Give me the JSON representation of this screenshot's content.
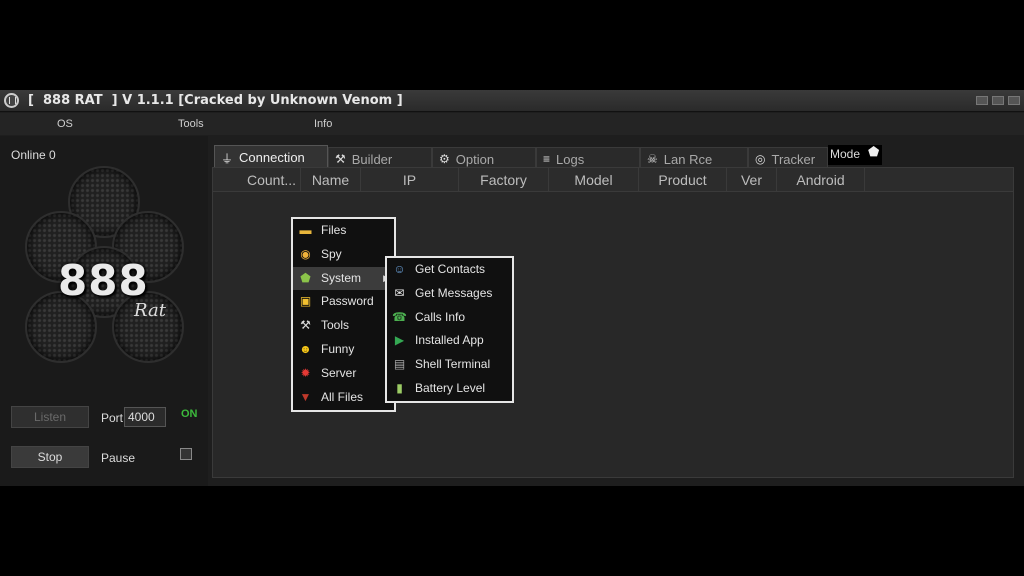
{
  "window": {
    "title": "[  888 RAT  ] V 1.1.1 [Cracked by Unknown Venom ]",
    "menu": [
      "OS",
      "Tools",
      "Info"
    ]
  },
  "sidebar": {
    "online_label": "Online 0",
    "logo_text": "888",
    "logo_sub": "Rat",
    "listen_label": "Listen",
    "stop_label": "Stop",
    "port_label": "Port",
    "port_value": "4000",
    "status_on": "ON",
    "pause_label": "Pause"
  },
  "tabs": [
    {
      "label": "Connection",
      "icon": "plug-icon",
      "active": true
    },
    {
      "label": "Builder",
      "icon": "tools-icon"
    },
    {
      "label": "Option",
      "icon": "gear-icon"
    },
    {
      "label": "Logs",
      "icon": "database-icon"
    },
    {
      "label": "Lan Rce",
      "icon": "skull-icon"
    },
    {
      "label": "Tracker",
      "icon": "globe-icon"
    }
  ],
  "mode_label": "Mode",
  "columns": [
    "Count...",
    "Name",
    "IP",
    "Factory",
    "Model",
    "Product",
    "Ver",
    "Android"
  ],
  "context_menu": [
    {
      "label": "Files",
      "icon": "folder-icon",
      "color": "#e8b63c"
    },
    {
      "label": "Spy",
      "icon": "eye-icon",
      "color": "#f0b23a"
    },
    {
      "label": "System",
      "icon": "android-icon",
      "color": "#8bc34a",
      "submenu": true
    },
    {
      "label": "Password",
      "icon": "lock-icon",
      "color": "#f2c030"
    },
    {
      "label": "Tools",
      "icon": "tools-icon",
      "color": "#dddddd"
    },
    {
      "label": "Funny",
      "icon": "smiley-icon",
      "color": "#f5c518"
    },
    {
      "label": "Server",
      "icon": "virus-icon",
      "color": "#e53935"
    },
    {
      "label": "All Files",
      "icon": "download-icon",
      "color": "#c0392b"
    }
  ],
  "submenu": [
    {
      "label": "Get Contacts",
      "icon": "contacts-icon",
      "color": "#6aa0d8"
    },
    {
      "label": "Get Messages",
      "icon": "envelope-icon",
      "color": "#eeeeee"
    },
    {
      "label": "Calls Info",
      "icon": "phone-icon",
      "color": "#4caf50"
    },
    {
      "label": "Installed App",
      "icon": "play-store-icon",
      "color": "#34a853"
    },
    {
      "label": "Shell Terminal",
      "icon": "terminal-icon",
      "color": "#aaaaaa"
    },
    {
      "label": "Battery Level",
      "icon": "battery-icon",
      "color": "#9ccc65"
    }
  ]
}
